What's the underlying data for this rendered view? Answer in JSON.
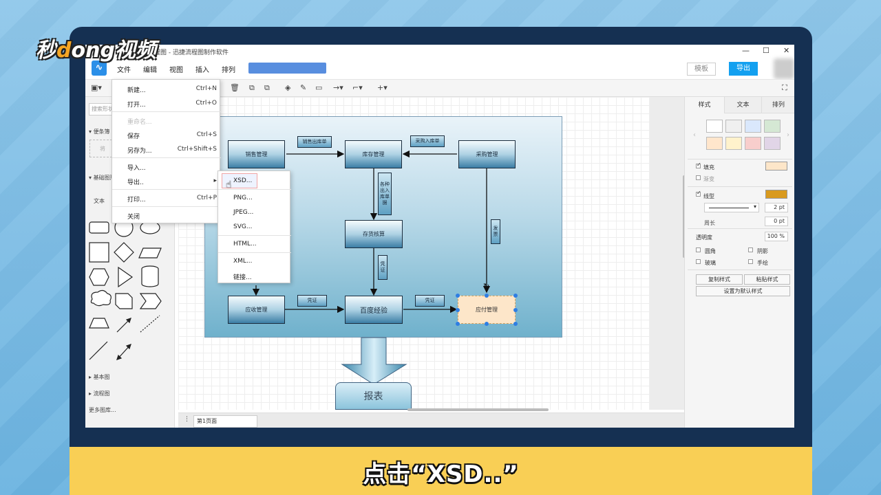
{
  "window": {
    "title": "程图 - 迅捷流程图制作软件",
    "controls": [
      "—",
      "☐",
      "✕"
    ]
  },
  "watermark": {
    "logo_text_1": "秒",
    "logo_dot": "d",
    "logo_text_2": "ong视频"
  },
  "menubar": {
    "items": [
      "文件",
      "编辑",
      "视图",
      "插入",
      "排列"
    ],
    "template_button": "模板",
    "export_button": "导出"
  },
  "left_panel": {
    "search_placeholder": "搜索形状",
    "sections": [
      "便条簿",
      "基础图形",
      "文本",
      "基本图",
      "流程图",
      "更多图库..."
    ],
    "scratch_hint": "将"
  },
  "file_menu": {
    "items": [
      {
        "label": "新建...",
        "shortcut": "Ctrl+N",
        "disabled": false
      },
      {
        "label": "打开...",
        "shortcut": "Ctrl+O",
        "disabled": false
      },
      {
        "label": "重命名...",
        "shortcut": "",
        "disabled": true
      },
      {
        "label": "保存",
        "shortcut": "Ctrl+S",
        "disabled": false
      },
      {
        "label": "另存为...",
        "shortcut": "Ctrl+Shift+S",
        "disabled": false
      },
      {
        "label": "导入...",
        "shortcut": "",
        "disabled": false
      },
      {
        "label": "导出..",
        "shortcut": "▸",
        "disabled": false
      },
      {
        "label": "打印...",
        "shortcut": "Ctrl+P",
        "disabled": false
      },
      {
        "label": "关闭",
        "shortcut": "",
        "disabled": false
      }
    ]
  },
  "export_submenu": {
    "items": [
      "XSD...",
      "PNG...",
      "JPEG...",
      "SVG...",
      "HTML...",
      "XML...",
      "链接..."
    ],
    "highlighted": "XSD..."
  },
  "diagram": {
    "nodes": {
      "sales": "销售管理",
      "inventory": "库存管理",
      "purchase": "采购管理",
      "accounting": "存货核算",
      "receivable": "应收管理",
      "baidu": "百度经验",
      "payable": "应付管理",
      "report": "报表"
    },
    "labels": {
      "sales_order": "销售出库单",
      "purchase_order": "采购入库单",
      "io_doc": "各种出入库单据",
      "voucher1": "凭证",
      "voucher2": "凭证",
      "voucher3": "凭证",
      "invoice": "发票"
    }
  },
  "bottom": {
    "page_tab": "第1页面"
  },
  "right_panel": {
    "tabs": [
      "样式",
      "文本",
      "排列"
    ],
    "fill_label": "填充",
    "gradient_label": "渐变",
    "line_label": "线型",
    "line_width": "2 pt",
    "perimeter_label": "周长",
    "perimeter_value": "0 pt",
    "opacity_label": "透明度",
    "opacity_value": "100 %",
    "rounded_label": "圆角",
    "shadow_label": "阴影",
    "glass_label": "玻璃",
    "sketch_label": "手绘",
    "copy_style": "复制样式",
    "paste_style": "粘贴样式",
    "set_default": "设置为默认样式",
    "swatches": [
      "#ffffff",
      "#f0f0f0",
      "#dae8fc",
      "#d5e8d4",
      "#ffe6cc",
      "#fff2cc",
      "#f8cecc",
      "#e1d5e7"
    ],
    "fill_color": "#fde6c9",
    "line_color": "#d99a1e"
  },
  "caption": "点击“XSD..”"
}
